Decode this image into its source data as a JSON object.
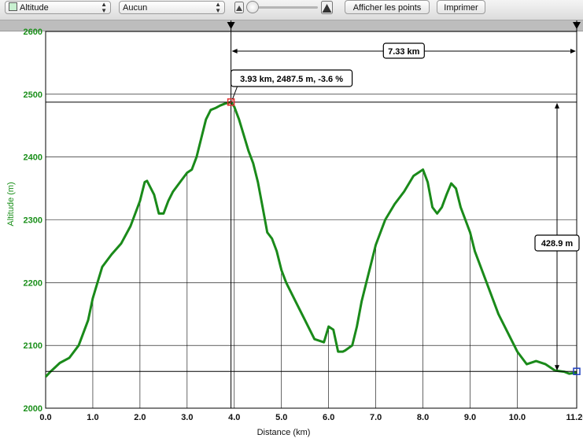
{
  "toolbar": {
    "series_select": "Altitude",
    "compare_select": "Aucun",
    "show_points_button": "Afficher les points",
    "print_button": "Imprimer",
    "zoom_small_icon": "mountain-small-icon",
    "zoom_large_icon": "mountain-large-icon"
  },
  "colors": {
    "series": "#1a8a1a",
    "y_axis_text": "#1a8f1a",
    "cursor_marker": "#e03030",
    "end_marker": "#2040c0"
  },
  "chart_data": {
    "type": "line",
    "xlabel": "Distance (km)",
    "ylabel": "Altitude (m)",
    "xlim": [
      0,
      11.26
    ],
    "ylim": [
      2000,
      2600
    ],
    "x_ticks": [
      "0.0",
      "1.0",
      "2.0",
      "3.0",
      "4.0",
      "5.0",
      "6.0",
      "7.0",
      "8.0",
      "9.0",
      "10.0",
      "11.26"
    ],
    "y_ticks": [
      "2000",
      "2100",
      "2200",
      "2300",
      "2400",
      "2500",
      "2600"
    ],
    "grid": true,
    "series": [
      {
        "x": [
          0.0,
          0.1,
          0.2,
          0.3,
          0.5,
          0.7,
          0.9,
          1.0,
          1.2,
          1.4,
          1.6,
          1.8,
          1.9,
          2.0,
          2.1,
          2.15,
          2.3,
          2.4,
          2.5,
          2.6,
          2.7,
          2.9,
          3.0,
          3.1,
          3.2,
          3.3,
          3.4,
          3.5,
          3.6,
          3.7,
          3.8,
          3.93,
          4.0,
          4.1,
          4.2,
          4.3,
          4.4,
          4.5,
          4.6,
          4.7,
          4.8,
          4.9,
          5.0,
          5.1,
          5.3,
          5.5,
          5.7,
          5.9,
          6.0,
          6.1,
          6.2,
          6.3,
          6.35,
          6.5,
          6.6,
          6.7,
          6.8,
          6.9,
          7.0,
          7.2,
          7.4,
          7.6,
          7.8,
          8.0,
          8.1,
          8.2,
          8.3,
          8.4,
          8.5,
          8.6,
          8.7,
          8.8,
          8.9,
          9.0,
          9.1,
          9.2,
          9.4,
          9.6,
          9.8,
          10.0,
          10.2,
          10.4,
          10.6,
          10.8,
          10.9,
          11.0,
          11.1,
          11.2,
          11.26
        ],
        "y": [
          2050,
          2058,
          2065,
          2072,
          2080,
          2100,
          2140,
          2175,
          2225,
          2245,
          2262,
          2290,
          2310,
          2330,
          2360,
          2362,
          2340,
          2310,
          2310,
          2330,
          2345,
          2365,
          2375,
          2380,
          2400,
          2430,
          2460,
          2475,
          2478,
          2482,
          2485,
          2487.5,
          2480,
          2460,
          2435,
          2410,
          2390,
          2360,
          2320,
          2280,
          2270,
          2250,
          2220,
          2200,
          2170,
          2140,
          2110,
          2105,
          2130,
          2125,
          2090,
          2090,
          2092,
          2100,
          2130,
          2170,
          2200,
          2230,
          2260,
          2300,
          2325,
          2345,
          2370,
          2380,
          2360,
          2320,
          2310,
          2320,
          2340,
          2358,
          2350,
          2320,
          2300,
          2280,
          2250,
          2230,
          2190,
          2150,
          2120,
          2090,
          2070,
          2075,
          2070,
          2060,
          2059,
          2058,
          2055,
          2056,
          2056
        ]
      }
    ],
    "annotations": {
      "cursor_label": "3.93 km, 2487.5 m, -3.6 %",
      "cursor_point": [
        3.93,
        2487.5
      ],
      "end_point": [
        11.26,
        2058.6
      ],
      "distance_span": [
        3.93,
        11.26
      ],
      "distance_label": "7.33 km",
      "altitude_span": [
        2058.6,
        2487.5
      ],
      "altitude_label": "428.9 m"
    }
  }
}
